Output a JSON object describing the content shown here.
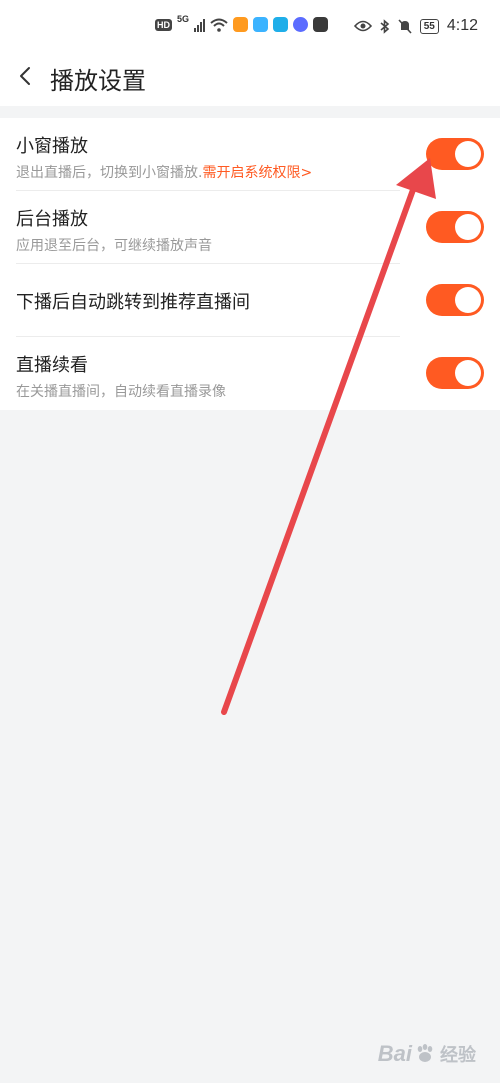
{
  "status_bar": {
    "hd": "HD",
    "network": "5G",
    "battery": "55",
    "time": "4:12"
  },
  "header": {
    "title": "播放设置",
    "back_icon": "chevron-left-icon"
  },
  "settings": [
    {
      "title": "小窗播放",
      "subtitle": "退出直播后，切换到小窗播放.",
      "link": "需开启系统权限>",
      "enabled": true
    },
    {
      "title": "后台播放",
      "subtitle": "应用退至后台，可继续播放声音",
      "enabled": true
    },
    {
      "title": "下播后自动跳转到推荐直播间",
      "enabled": true
    },
    {
      "title": "直播续看",
      "subtitle": "在关播直播间，自动续看直播录像",
      "enabled": true
    }
  ],
  "colors": {
    "accent": "#ff5a22",
    "annotation_arrow": "#e8474b",
    "background": "#f3f4f5"
  },
  "watermark": {
    "logo_text": "Bai",
    "suffix": "经验"
  }
}
